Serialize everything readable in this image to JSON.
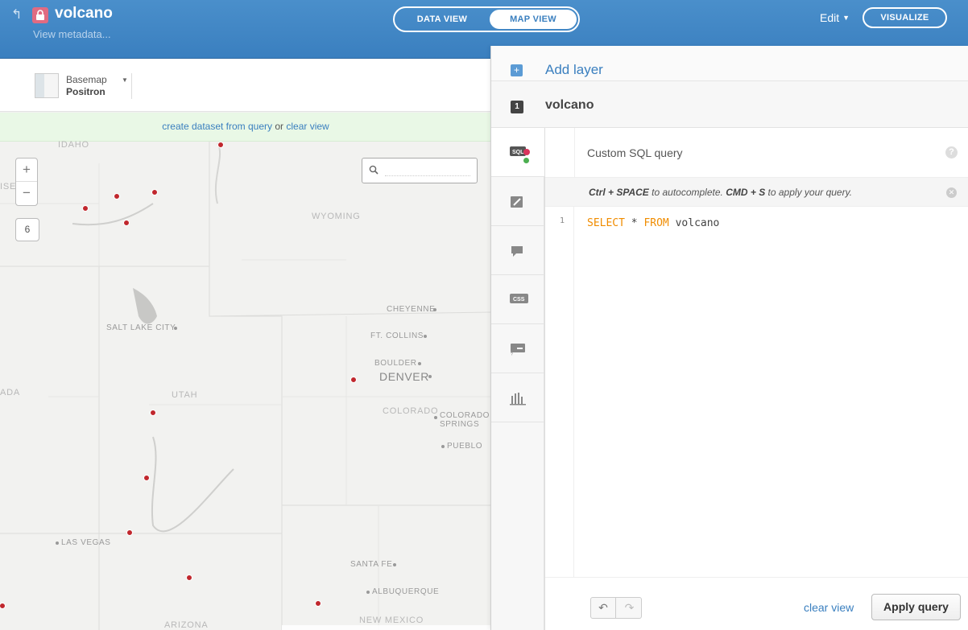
{
  "header": {
    "title": "volcano",
    "metadata_link": "View metadata...",
    "data_view": "DATA VIEW",
    "map_view": "MAP VIEW",
    "edit": "Edit",
    "visualize": "VISUALIZE"
  },
  "map": {
    "basemap_label": "Basemap",
    "basemap_value": "Positron",
    "notice_action1": "create dataset from query",
    "notice_or": " or ",
    "notice_action2": "clear view",
    "zoom_in": "+",
    "zoom_out": "−",
    "zoom_level": "6",
    "labels": {
      "idaho": "IDAHO",
      "wyoming": "WYOMING",
      "utah": "UTAH",
      "cheyenne": "CHEYENNE",
      "salt_lake_city": "SALT LAKE CITY",
      "fort_collins": "FT. COLLINS",
      "boulder": "BOULDER",
      "denver": "DENVER",
      "colorado": "COLORADO",
      "colorado_springs_1": "COLORADO",
      "colorado_springs_2": "SPRINGS",
      "pueblo": "PUEBLO",
      "las_vegas": "LAS VEGAS",
      "santa_fe": "SANTA FE",
      "albuquerque": "ALBUQUERQUE",
      "new_mexico": "NEW MEXICO",
      "arizona": "ARIZONA",
      "ise": "ISE",
      "ada": "ADA"
    }
  },
  "panel": {
    "add_layer": "Add layer",
    "layer_number": "1",
    "layer_name": "volcano",
    "editor_title": "Custom SQL query",
    "help": "?",
    "hint_ctrl": "Ctrl + SPACE",
    "hint_mid": " to autocomplete. ",
    "hint_cmd": "CMD + S",
    "hint_end": " to apply your query.",
    "line_number": "1",
    "sql_select": "SELECT",
    "sql_star": " * ",
    "sql_from": "FROM",
    "sql_table": " volcano",
    "clear_view": "clear view",
    "apply_query": "Apply query",
    "undo": "↶",
    "redo": "↷"
  },
  "colors": {
    "header_blue": "#3a7fbf",
    "volcano_dot": "#c0272d",
    "sql_keyword": "#f08c00",
    "notice_bg": "#e9f8e6"
  }
}
